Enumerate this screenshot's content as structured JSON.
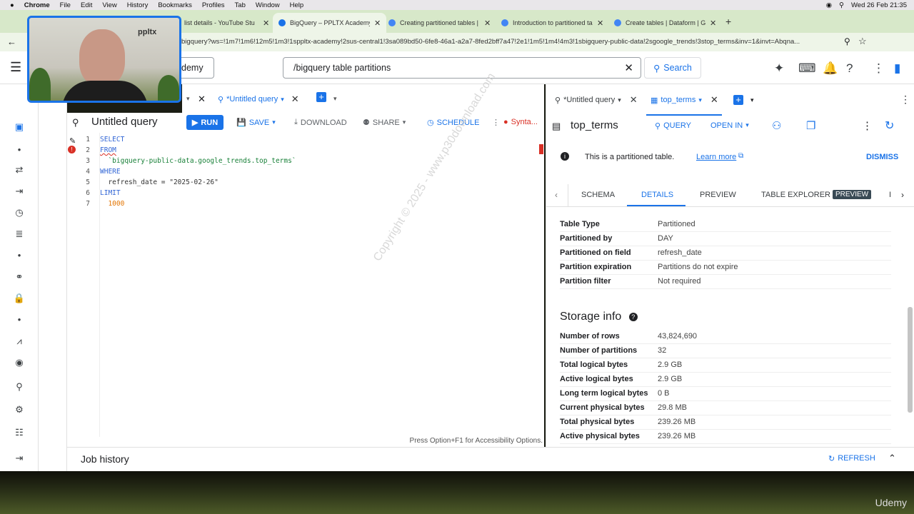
{
  "menubar": {
    "apple": "",
    "app": "Chrome",
    "items": [
      "File",
      "Edit",
      "View",
      "History",
      "Bookmarks",
      "Profiles",
      "Tab",
      "Window",
      "Help"
    ],
    "clock": "Wed 26 Feb  21:35"
  },
  "browser": {
    "tabs": [
      {
        "title": "list details - YouTube Stu"
      },
      {
        "title": "BigQuery – PPLTX Academy"
      },
      {
        "title": "Creating partitioned tables |"
      },
      {
        "title": "Introduction to partitioned ta"
      },
      {
        "title": "Create tables | Dataform | G"
      }
    ],
    "url": "bigquery?ws=!1m7!1m6!12m5!1m3!1sppltx-academy!2sus-central1!3sa089bd50-6fe8-46a1-a2a7-8fed2bff7a47!2e1!1m5!1m4!4m3!1sbigquery-public-data!2sgoogle_trends!3stop_terms&inv=1&invt=Abqna..."
  },
  "header": {
    "project_suffix": "demy",
    "search_value": "/bigquery table partitions",
    "search_button": "Search"
  },
  "webcam": {
    "logo": "ppltx"
  },
  "editor": {
    "tab_label": "*Untitled query",
    "title": "Untitled query",
    "run": "RUN",
    "save": "SAVE",
    "download": "DOWNLOAD",
    "share": "SHARE",
    "schedule": "SCHEDULE",
    "syntax": "Synta...",
    "lines": [
      {
        "n": "1",
        "text": "SELECT"
      },
      {
        "n": "2",
        "text": "FROM"
      },
      {
        "n": "3",
        "text": "  `bigquery-public-data.google_trends.top_terms`"
      },
      {
        "n": "4",
        "text": "WHERE"
      },
      {
        "n": "5",
        "text": "  refresh_date = \"2025-02-26\""
      },
      {
        "n": "6",
        "text": "LIMIT"
      },
      {
        "n": "7",
        "text": "  1000"
      }
    ],
    "accessibility": "Press Option+F1 for Accessibility Options.",
    "watermark": "Copyright © 2025 - www.p30download.com"
  },
  "rightpanel": {
    "tab1": "*Untitled query",
    "tab2": "top_terms",
    "table_name": "top_terms",
    "query": "QUERY",
    "open_in": "OPEN IN",
    "notice": "This is a partitioned table.",
    "learn_more": "Learn more",
    "dismiss": "DISMISS",
    "subtabs": {
      "schema": "SCHEMA",
      "details": "DETAILS",
      "preview": "PREVIEW",
      "explorer": "TABLE EXPLORER",
      "explorer_badge": "PREVIEW",
      "cut": "I"
    },
    "details": [
      {
        "k": "Table Type",
        "v": "Partitioned"
      },
      {
        "k": "Partitioned by",
        "v": "DAY"
      },
      {
        "k": "Partitioned on field",
        "v": "refresh_date"
      },
      {
        "k": "Partition expiration",
        "v": "Partitions do not expire"
      },
      {
        "k": "Partition filter",
        "v": "Not required"
      }
    ],
    "storage_title": "Storage info",
    "storage": [
      {
        "k": "Number of rows",
        "v": "43,824,690"
      },
      {
        "k": "Number of partitions",
        "v": "32"
      },
      {
        "k": "Total logical bytes",
        "v": "2.9 GB"
      },
      {
        "k": "Active logical bytes",
        "v": "2.9 GB"
      },
      {
        "k": "Long term logical bytes",
        "v": "0 B"
      },
      {
        "k": "Current physical bytes",
        "v": "29.8 MB"
      },
      {
        "k": "Total physical bytes",
        "v": "239.26 MB"
      },
      {
        "k": "Active physical bytes",
        "v": "239.26 MB"
      }
    ]
  },
  "jobhistory": {
    "title": "Job history",
    "refresh": "REFRESH"
  },
  "udemy": "Udemy",
  "colors": {
    "accent": "#1a73e8",
    "error": "#d93025",
    "tabbar": "#d7e8c9"
  }
}
